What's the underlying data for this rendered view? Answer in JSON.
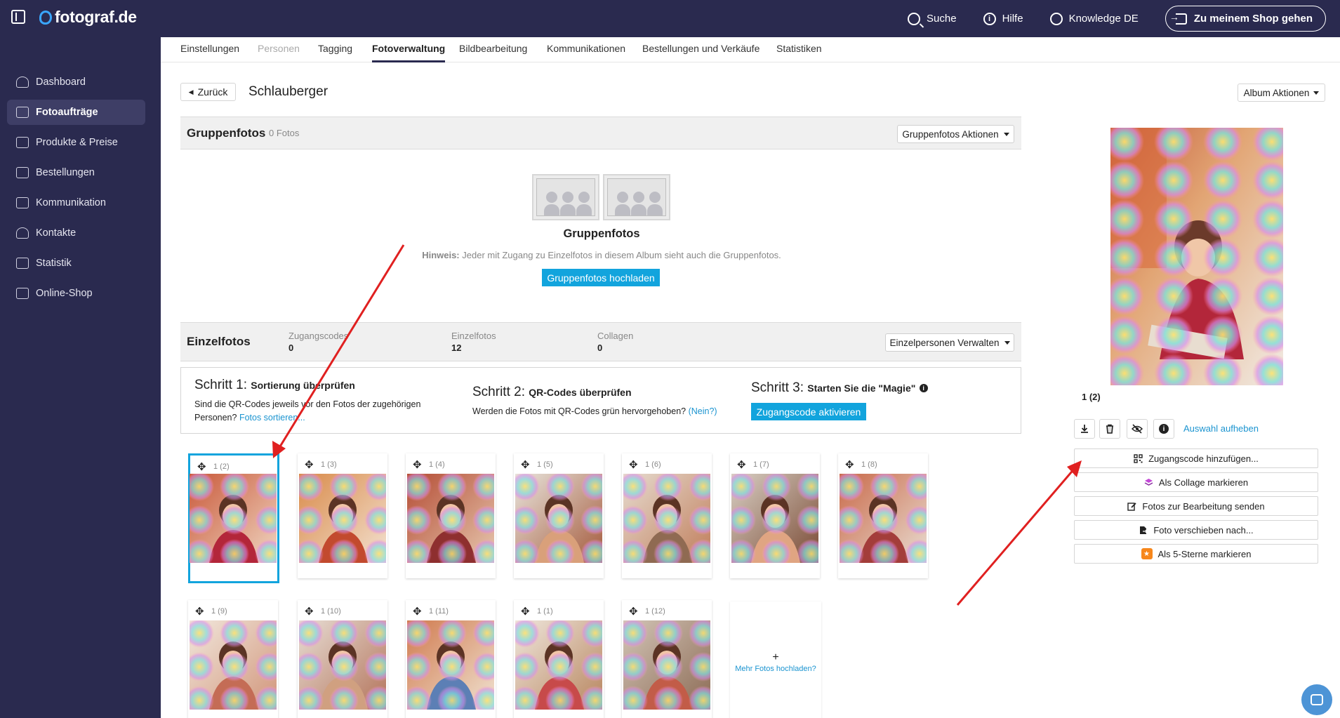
{
  "app": {
    "brand": "fotograf.de"
  },
  "topbar": {
    "search": "Suche",
    "help": "Hilfe",
    "account": "Knowledge DE",
    "shop": "Zu meinem Shop gehen"
  },
  "sidebar": {
    "items": [
      {
        "label": "Dashboard"
      },
      {
        "label": "Fotoaufträge"
      },
      {
        "label": "Produkte & Preise"
      },
      {
        "label": "Bestellungen"
      },
      {
        "label": "Kommunikation"
      },
      {
        "label": "Kontakte"
      },
      {
        "label": "Statistik"
      },
      {
        "label": "Online-Shop"
      }
    ],
    "active": "Fotoaufträge"
  },
  "tabs": [
    {
      "label": "Einstellungen"
    },
    {
      "label": "Personen"
    },
    {
      "label": "Tagging"
    },
    {
      "label": "Fotoverwaltung"
    },
    {
      "label": "Bildbearbeitung"
    },
    {
      "label": "Kommunikationen"
    },
    {
      "label": "Bestellungen und Verkäufe"
    },
    {
      "label": "Statistiken"
    }
  ],
  "header": {
    "back": "Zurück",
    "title": "Schlauberger",
    "album_actions": "Album Aktionen"
  },
  "group": {
    "title": "Gruppenfotos",
    "count": "0 Fotos",
    "actions": "Gruppenfotos Aktionen",
    "empty_title": "Gruppenfotos",
    "hint_label": "Hinweis:",
    "hint_text": " Jeder mit Zugang zu Einzelfotos in diesem Album sieht auch die Gruppenfotos.",
    "upload": "Gruppenfotos hochladen"
  },
  "single": {
    "title": "Einzelfotos",
    "stats": [
      {
        "label": "Zugangscodes",
        "value": "0"
      },
      {
        "label": "Einzelfotos",
        "value": "12"
      },
      {
        "label": "Collagen",
        "value": "0"
      }
    ],
    "manage": "Einzelpersonen Verwalten"
  },
  "steps": [
    {
      "head": "Schritt 1:",
      "sub": "Sortierung überprüfen",
      "text": "Sind die QR-Codes jeweils vor den Fotos der zugehörigen Personen? ",
      "link": "Fotos sortieren..."
    },
    {
      "head": "Schritt 2:",
      "sub": "QR-Codes überprüfen",
      "text": "Werden die Fotos mit QR-Codes grün hervorgehoben? ",
      "link": "(Nein?)"
    },
    {
      "head": "Schritt 3:",
      "sub": "Starten Sie die \"Magie\"",
      "button": "Zugangscode aktivieren"
    }
  ],
  "photos": [
    {
      "label": "1 (2)"
    },
    {
      "label": "1 (3)"
    },
    {
      "label": "1 (4)"
    },
    {
      "label": "1 (5)"
    },
    {
      "label": "1 (6)"
    },
    {
      "label": "1 (7)"
    },
    {
      "label": "1 (8)"
    },
    {
      "label": "1 (9)"
    },
    {
      "label": "1 (10)"
    },
    {
      "label": "1 (11)"
    },
    {
      "label": "1 (1)"
    },
    {
      "label": "1 (12)"
    }
  ],
  "more_upload": {
    "plus": "+",
    "label": "Mehr Fotos hochladen?"
  },
  "preview": {
    "label": "1 (2)",
    "deselect": "Auswahl aufheben",
    "actions": [
      {
        "label": "Zugangscode hinzufügen...",
        "icon": "qr-code-icon"
      },
      {
        "label": "Als Collage markieren",
        "icon": "layers-icon"
      },
      {
        "label": "Fotos zur Bearbeitung senden",
        "icon": "edit-icon"
      },
      {
        "label": "Foto verschieben nach...",
        "icon": "move-file-icon"
      },
      {
        "label": "Als 5-Sterne markieren",
        "icon": "star-rating-icon"
      }
    ]
  },
  "colors": {
    "nav": "#2a2a4f",
    "accent": "#12a4dd",
    "link": "#1b94d0",
    "annotation_arrow": "#e02020"
  }
}
